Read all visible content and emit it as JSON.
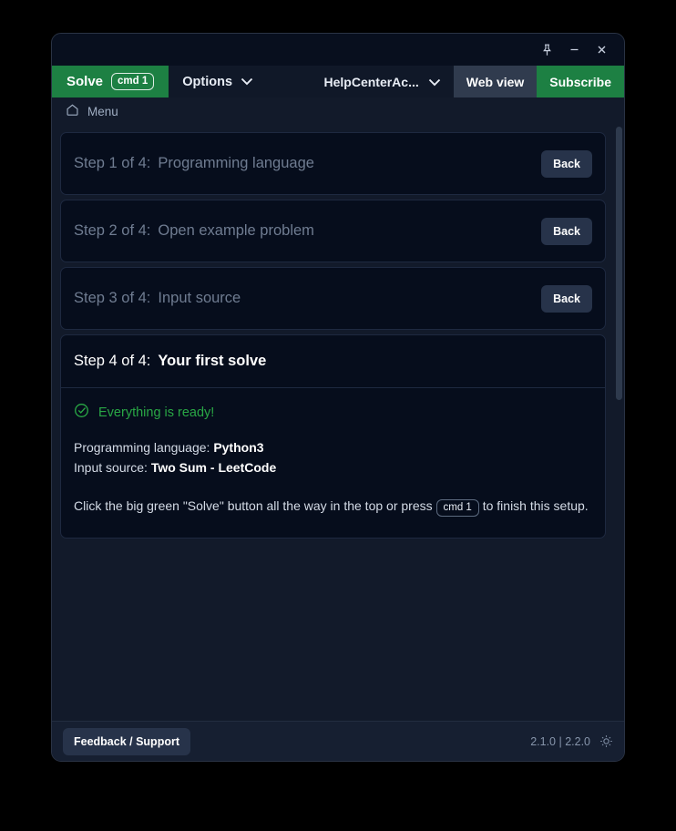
{
  "window": {
    "controls": [
      {
        "name": "pin",
        "label": "Pin"
      },
      {
        "name": "minimize",
        "label": "Minimize"
      },
      {
        "name": "close",
        "label": "Close"
      }
    ]
  },
  "toolbar": {
    "solve_label": "Solve",
    "solve_shortcut": "cmd 1",
    "options_label": "Options",
    "account_label": "HelpCenterAc...",
    "webview_label": "Web view",
    "subscribe_label": "Subscribe"
  },
  "breadcrumb": {
    "icon": "home-icon",
    "label": "Menu"
  },
  "steps": [
    {
      "label": "Step 1 of 4:",
      "name": "Programming language",
      "action": "Back",
      "state": "completed"
    },
    {
      "label": "Step 2 of 4:",
      "name": "Open example problem",
      "action": "Back",
      "state": "completed"
    },
    {
      "label": "Step 3 of 4:",
      "name": "Input source",
      "action": "Back",
      "state": "completed"
    }
  ],
  "active_step": {
    "label": "Step 4 of 4:",
    "name": "Your first solve",
    "status_icon": "check-circle-icon",
    "status_text": "Everything is ready!",
    "facts": [
      {
        "key": "Programming language:",
        "value": "Python3"
      },
      {
        "key": "Input source:",
        "value": "Two Sum - LeetCode"
      }
    ],
    "hint_before": "Click the big green \"Solve\" button all the way in the top or press",
    "hint_shortcut": "cmd 1",
    "hint_after": "to finish this setup."
  },
  "footer": {
    "feedback_label": "Feedback / Support",
    "version": "2.1.0 | 2.2.0",
    "theme_icon": "sun-icon"
  },
  "colors": {
    "green": "#1d8043",
    "green_text": "#29a745",
    "page_bg": "#121a2a",
    "card_bg": "#060d1c",
    "slate": "#303b4e"
  }
}
